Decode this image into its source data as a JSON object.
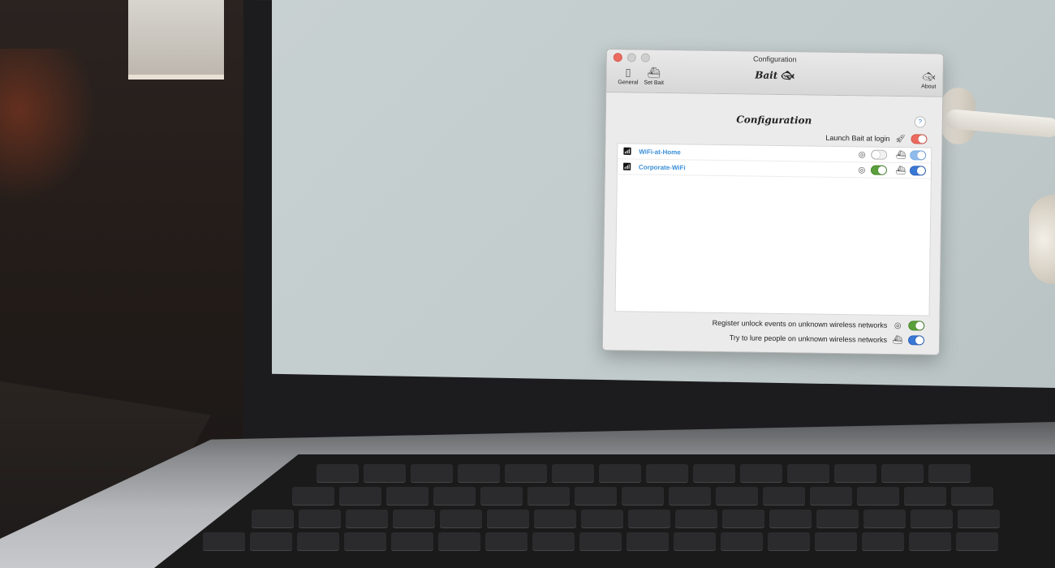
{
  "window": {
    "title": "Configuration",
    "toolbar": {
      "general_label": "General",
      "general_icon": "switch-icon",
      "setbait_label": "Set Bait",
      "setbait_icon": "boat-icon",
      "brand": "Bait",
      "brand_icon": "fish-icon",
      "about_label": "About",
      "about_icon": "fish-icon"
    }
  },
  "content": {
    "heading": "Configuration",
    "help": "?",
    "launch_label": "Launch Bait at login",
    "launch_toggle": true,
    "networks": [
      {
        "ssid": "WiFi-at-Home",
        "unlock_enabled": false,
        "lure_enabled": true
      },
      {
        "ssid": "Corporate-WiFi",
        "unlock_enabled": true,
        "lure_enabled": true
      }
    ],
    "register_label": "Register unlock events on unknown wireless networks",
    "register_toggle": true,
    "lure_label": "Try to lure people on unknown wireless networks",
    "lure_toggle": true
  },
  "colors": {
    "accent_blue": "#3a78d6",
    "green": "#5aa03b",
    "red": "#ec6b5f"
  }
}
